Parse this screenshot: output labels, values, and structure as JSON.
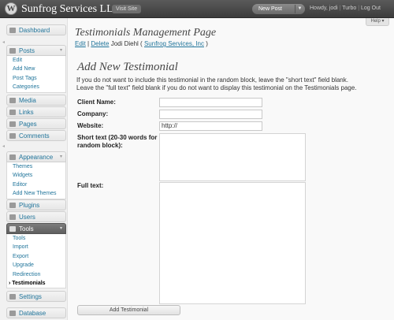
{
  "header": {
    "site_title": "Sunfrog Services LLC",
    "visit_site": "Visit Site",
    "new_post": "New Post",
    "howdy": "Howdy, jodi",
    "turbo": "Turbo",
    "logout": "Log Out",
    "help": "Help"
  },
  "sidebar": {
    "dashboard": "Dashboard",
    "posts": "Posts",
    "posts_items": [
      "Edit",
      "Add New",
      "Post Tags",
      "Categories"
    ],
    "media": "Media",
    "links": "Links",
    "pages": "Pages",
    "comments": "Comments",
    "appearance": "Appearance",
    "appearance_items": [
      "Themes",
      "Widgets",
      "Editor",
      "Add New Themes"
    ],
    "plugins": "Plugins",
    "users": "Users",
    "tools": "Tools",
    "tools_items": [
      "Tools",
      "Import",
      "Export",
      "Upgrade",
      "Redirection",
      "Testimonials"
    ],
    "settings": "Settings",
    "database": "Database"
  },
  "main": {
    "page_title": "Testimonials Management Page",
    "edit_link": "Edit",
    "delete_link": "Delete",
    "entry_name": "Jodi Diehl (",
    "entry_company": "Sunfrog Services, Inc",
    "entry_close": ")",
    "section_title": "Add New Testimonial",
    "intro_line1": "If you do not want to include this testimonial in the random block, leave the \"short text\" field blank.",
    "intro_line2": "Leave the \"full text\" field blank if you do not want to display this testimonial on the Testimonials page.",
    "client_name_label": "Client Name:",
    "company_label": "Company:",
    "website_label": "Website:",
    "website_value": "http://",
    "short_text_label": "Short text (20-30 words for random block):",
    "full_text_label": "Full text:",
    "submit_label": "Add Testimonial"
  }
}
